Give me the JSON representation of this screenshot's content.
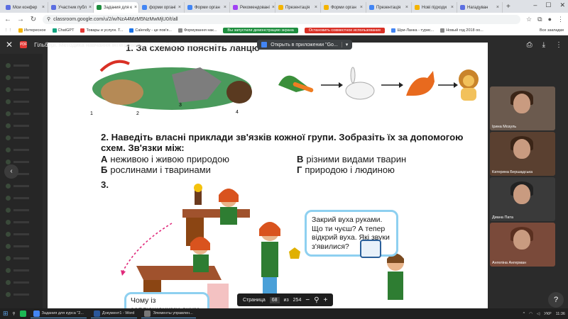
{
  "tabs": [
    {
      "label": "Мои конфер",
      "color": "#5b6ee1"
    },
    {
      "label": "Участник публ",
      "color": "#5b6ee1"
    },
    {
      "label": "Задания для к",
      "color": "#1e8e3e",
      "active": true
    },
    {
      "label": "форми органі",
      "color": "#4285f4"
    },
    {
      "label": "Форми орган",
      "color": "#4285f4"
    },
    {
      "label": "Рекомендовані",
      "color": "#a142f4"
    },
    {
      "label": "Презентація",
      "color": "#f4b400"
    },
    {
      "label": "Форми орган",
      "color": "#f4b400"
    },
    {
      "label": "Презентація",
      "color": "#4285f4"
    },
    {
      "label": "Нові підходи",
      "color": "#f4b400"
    },
    {
      "label": "Нагадуван",
      "color": "#5b6ee1"
    }
  ],
  "address": {
    "url": "classroom.google.com/u/2/w/NzA4MzM5NzMwMjU0/t/all"
  },
  "bookmarks": [
    "Интересное",
    "ChatGPT",
    "Товары и услуги. Т...",
    "Calendly - це пов'я...",
    "Формування нак..."
  ],
  "bookmarks_right": [
    "Шри-Ланка - турис...",
    "Новый год 2018 оо..."
  ],
  "all_bookmarks": "Все закладки",
  "share": {
    "started": "Вы запустили демонстрацию экрана",
    "stop": "Остановить совместное использование"
  },
  "viewer": {
    "file_title": "Гільберг. Методика навчання інтегрованого курсу ЯДС у 1-2 класах ЗЗСО.pdf",
    "open_in": "Открыть в приложении \"Go..."
  },
  "page": {
    "header_partial": "1. За схемою поясніть ланцю",
    "q2": "2. Наведіть власні приклади зв'язків кожної групи. Зобразіть їх за допомогою схем. Зв'язки між:",
    "options": [
      {
        "letter": "А",
        "text": "неживою і живою природою"
      },
      {
        "letter": "В",
        "text": "різними видами тварин"
      },
      {
        "letter": "Б",
        "text": "рослинами і тваринами"
      },
      {
        "letter": "Г",
        "text": "природою і людиною"
      }
    ],
    "q3": "3.",
    "bubble1": "Закрий вуха руками. Що ти чуєш? А тепер відкрий вуха. Які звуки з'явилися?",
    "bubble2": "Чому із заплющеними очим ви не змогли назвати зміни?"
  },
  "pager": {
    "label": "Страница",
    "current": "68",
    "of": "из",
    "total": "254"
  },
  "participants": [
    {
      "name": "Ірина Мозуль"
    },
    {
      "name": "Катерина Бершадська"
    },
    {
      "name": "Диана Пата"
    },
    {
      "name": "Ангеліна Ангерман"
    }
  ],
  "taskbar": {
    "apps": [
      "Задания для курса \"2...",
      "Документ1 - Word",
      "Элементы управлен..."
    ],
    "lang": "УКР",
    "time": "11:36"
  }
}
